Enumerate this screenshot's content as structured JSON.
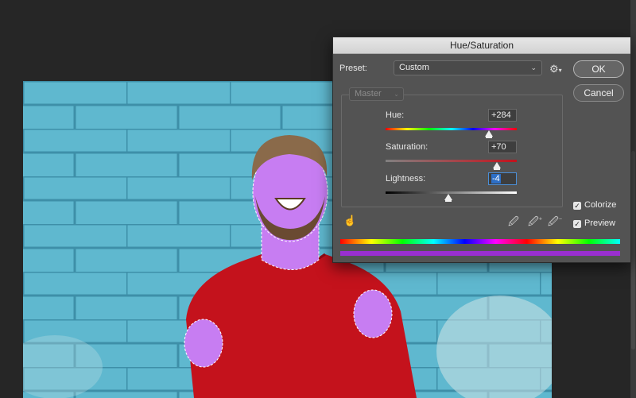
{
  "dialog": {
    "title": "Hue/Saturation",
    "preset_label": "Preset:",
    "preset_value": "Custom",
    "channel_value": "Master",
    "ok_label": "OK",
    "cancel_label": "Cancel",
    "hue_label": "Hue:",
    "hue_value": "+284",
    "saturation_label": "Saturation:",
    "saturation_value": "+70",
    "lightness_label": "Lightness:",
    "lightness_value": "-4",
    "colorize_label": "Colorize",
    "colorize_checked": true,
    "preview_label": "Preview",
    "preview_checked": true,
    "hue_level": 0.79,
    "saturation_level": 0.85,
    "lightness_level": 0.48
  },
  "icons": {
    "gear": "gear-icon",
    "hand": "targeted-adjustment-icon",
    "eyedropper": "eyedropper-icon",
    "eyedropper_plus": "eyedropper-plus-icon",
    "eyedropper_minus": "eyedropper-minus-icon"
  },
  "colors": {
    "background": "#262626",
    "dialog": "#535353",
    "wall": "#5fb8cf",
    "sweater": "#c4121c",
    "skin_tint": "#c77df2",
    "result_bar": "#9a2fd0"
  }
}
